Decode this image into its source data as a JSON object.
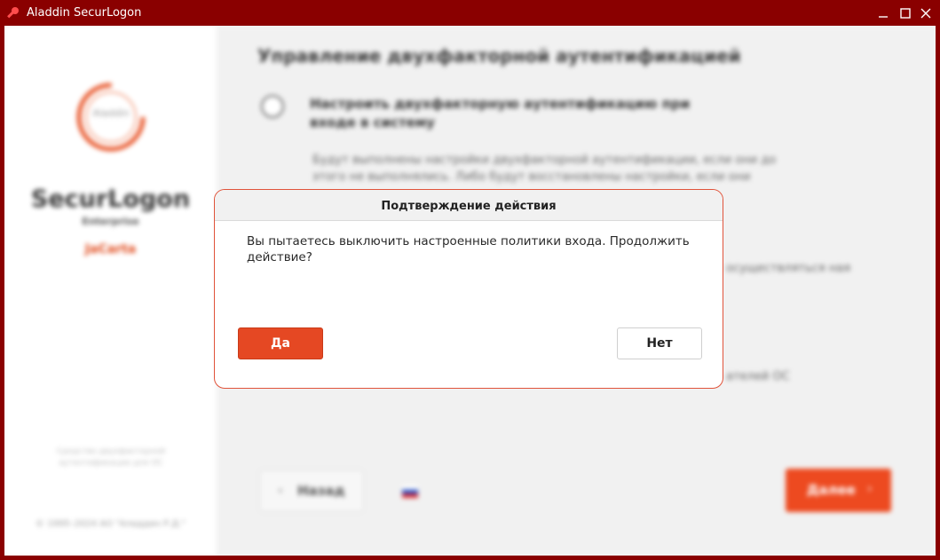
{
  "window": {
    "title": "Aladdin SecurLogon",
    "frame_color": "#8a0000"
  },
  "sidebar": {
    "logo_text": "Aladdin",
    "product_name": "SecurLogon",
    "edition": "Enterprise",
    "sub_brand": "JaCarta",
    "note": "Средство двухфакторной аутентификации для ОС",
    "copyright": "© 1995–2024 АО \"Аладдин Р.Д.\""
  },
  "main": {
    "title": "Управление двухфакторной аутентификацией",
    "option_title": "Настроить двухфакторную аутентификацию при входе в систему",
    "option_desc": "Будут выполнены настройки двухфакторной аутентификации, если они до этого не выполнялись. Либо будут восстановлены настройки, если они",
    "right_text1": "осуществляться ная",
    "right_text2": "ателей ОС",
    "back_label": "Назад",
    "next_label": "Далее",
    "accent_color": "#ed4a20"
  },
  "dialog": {
    "title": "Подтверждение действия",
    "message": "Вы пытаетесь выключить настроенные политики входа. Продолжить действие?",
    "yes_label": "Да",
    "no_label": "Нет"
  }
}
